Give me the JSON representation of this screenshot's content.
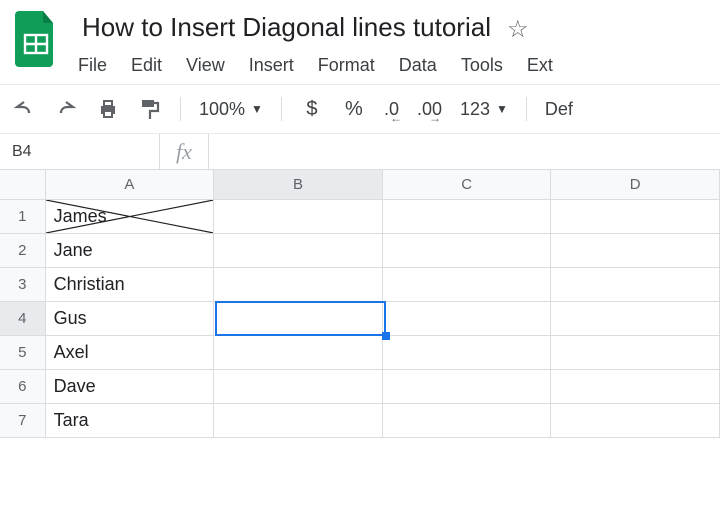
{
  "header": {
    "title": "How to Insert Diagonal lines tutorial"
  },
  "menubar": {
    "items": [
      "File",
      "Edit",
      "View",
      "Insert",
      "Format",
      "Data",
      "Tools",
      "Ext"
    ]
  },
  "toolbar": {
    "zoom": "100%",
    "currency": "$",
    "percent": "%",
    "dec_dec": ".0",
    "inc_dec": ".00",
    "num_format": "123",
    "font": "Def"
  },
  "namebox": "B4",
  "fx_placeholder": "fx",
  "columns": [
    "A",
    "B",
    "C",
    "D"
  ],
  "rows": [
    {
      "num": "1",
      "A": "James"
    },
    {
      "num": "2",
      "A": "Jane"
    },
    {
      "num": "3",
      "A": "Christian"
    },
    {
      "num": "4",
      "A": "Gus"
    },
    {
      "num": "5",
      "A": "Axel"
    },
    {
      "num": "6",
      "A": "Dave"
    },
    {
      "num": "7",
      "A": "Tara"
    }
  ],
  "active_cell": "B4"
}
